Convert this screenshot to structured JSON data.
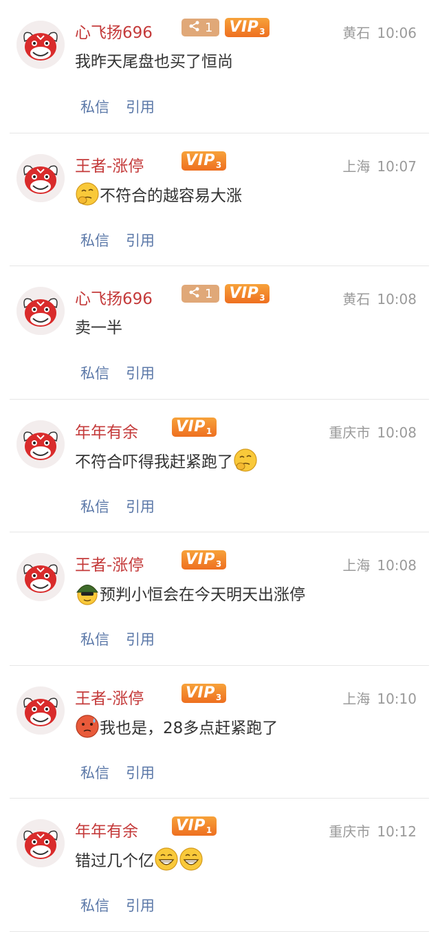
{
  "actions": {
    "message_label": "私信",
    "quote_label": "引用"
  },
  "colors": {
    "username": "#c43a3a",
    "vip_badge": "#f08a2a",
    "share_badge": "#e0a878",
    "action_link": "#5b78a8",
    "meta_text": "#9a9a9a"
  },
  "comments": [
    {
      "username": "心飞扬696",
      "share_count": "1",
      "vip": {
        "prefix": "VIP",
        "level": "3"
      },
      "location": "黄石",
      "time": "10:06",
      "text_pre": "",
      "text_post": "我昨天尾盘也买了恒尚",
      "emoji_before": "",
      "emoji_after": []
    },
    {
      "username": "王者-涨停",
      "share_count": "",
      "vip": {
        "prefix": "VIP",
        "level": "3"
      },
      "location": "上海",
      "time": "10:07",
      "text_pre": "",
      "text_post": "不符合的越容易大涨",
      "emoji_before": "thinking-emoji",
      "emoji_after": []
    },
    {
      "username": "心飞扬696",
      "share_count": "1",
      "vip": {
        "prefix": "VIP",
        "level": "3"
      },
      "location": "黄石",
      "time": "10:08",
      "text_pre": "",
      "text_post": "卖一半",
      "emoji_before": "",
      "emoji_after": []
    },
    {
      "username": "年年有余",
      "share_count": "",
      "vip": {
        "prefix": "VIP",
        "level": "1"
      },
      "location": "重庆市",
      "time": "10:08",
      "text_pre": "",
      "text_post": "不符合吓得我赶紧跑了",
      "emoji_before": "",
      "emoji_after": [
        "thinking-emoji"
      ]
    },
    {
      "username": "王者-涨停",
      "share_count": "",
      "vip": {
        "prefix": "VIP",
        "level": "3"
      },
      "location": "上海",
      "time": "10:08",
      "text_pre": "",
      "text_post": "预判小恒会在今天明天出涨停",
      "emoji_before": "soldier-emoji",
      "emoji_after": []
    },
    {
      "username": "王者-涨停",
      "share_count": "",
      "vip": {
        "prefix": "VIP",
        "level": "3"
      },
      "location": "上海",
      "time": "10:10",
      "text_pre": "",
      "text_post": "我也是，28多点赶紧跑了",
      "emoji_before": "sweat-emoji",
      "emoji_after": []
    },
    {
      "username": "年年有余",
      "share_count": "",
      "vip": {
        "prefix": "VIP",
        "level": "1"
      },
      "location": "重庆市",
      "time": "10:12",
      "text_pre": "",
      "text_post": "错过几个亿",
      "emoji_before": "",
      "emoji_after": [
        "grin-emoji",
        "grin-emoji"
      ]
    }
  ]
}
